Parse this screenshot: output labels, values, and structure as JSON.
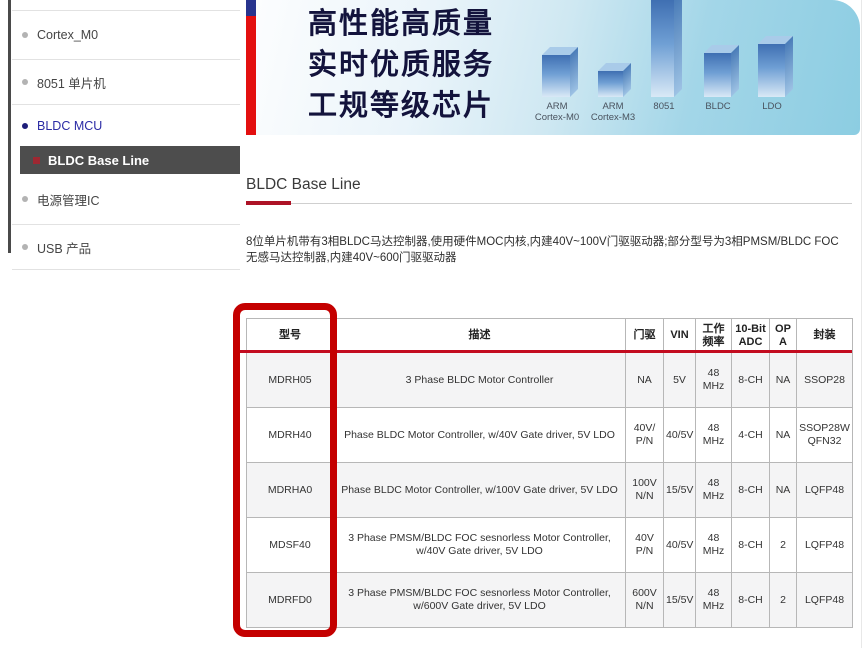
{
  "sidebar": {
    "items": [
      {
        "label": "Cortex_M0"
      },
      {
        "label": "8051 单片机"
      },
      {
        "label": "BLDC MCU"
      },
      {
        "label": "BLDC Base Line"
      },
      {
        "label": "电源管理IC"
      },
      {
        "label": "USB 产品"
      }
    ]
  },
  "banner": {
    "slogan_line1": "高性能高质量",
    "slogan_line2": "实时优质服务",
    "slogan_line3": "工规等级芯片",
    "chips": [
      {
        "label": "ARM\nCortex-M0"
      },
      {
        "label": "ARM\nCortex-M3"
      },
      {
        "label": "8051"
      },
      {
        "label": "BLDC"
      },
      {
        "label": "LDO"
      }
    ]
  },
  "page": {
    "title": "BLDC Base Line",
    "description": "8位单片机带有3相BLDC马达控制器,使用硬件MOC内核,内建40V~100V门驱驱动器;部分型号为3相PMSM/BLDC FOC\n无感马达控制器,内建40V~600门驱驱动器"
  },
  "table": {
    "headers": [
      "型号",
      "描述",
      "门驱",
      "VIN",
      "工作频率",
      "10-Bit ADC",
      "OPA",
      "封装"
    ],
    "rows": [
      {
        "model": "MDRH05",
        "description": "3 Phase BLDC Motor Controller",
        "gate": "NA",
        "vin": "5V",
        "freq": "48\nMHz",
        "adc": "8-CH",
        "opa": "NA",
        "package": "SSOP28"
      },
      {
        "model": "MDRH40",
        "description": "Phase BLDC Motor Controller, w/40V Gate driver, 5V LDO",
        "gate": "40V/\nP/N",
        "vin": "40/5V",
        "freq": "48\nMHz",
        "adc": "4-CH",
        "opa": "NA",
        "package": "SSOP28W\nQFN32"
      },
      {
        "model": "MDRHA0",
        "description": "Phase BLDC Motor Controller, w/100V Gate driver, 5V LDO",
        "gate": "100V\nN/N",
        "vin": "15/5V",
        "freq": "48\nMHz",
        "adc": "8-CH",
        "opa": "NA",
        "package": "LQFP48"
      },
      {
        "model": "MDSF40",
        "description": "3 Phase PMSM/BLDC FOC sesnorless Motor Controller,\nw/40V Gate driver, 5V LDO",
        "gate": "40V\nP/N",
        "vin": "40/5V",
        "freq": "48\nMHz",
        "adc": "8-CH",
        "opa": "2",
        "package": "LQFP48"
      },
      {
        "model": "MDRFD0",
        "description": "3 Phase PMSM/BLDC FOC sesnorless Motor Controller,\nw/600V Gate driver, 5V LDO",
        "gate": "600V\nN/N",
        "vin": "15/5V",
        "freq": "48\nMHz",
        "adc": "8-CH",
        "opa": "2",
        "package": "LQFP48"
      }
    ]
  },
  "colors": {
    "annotation_red": "#c40000",
    "header_rule_red": "#c30c20",
    "title_rule_red": "#ad1226",
    "banner_bar_red": "#e30f0f",
    "banner_bar_blue": "#28348e",
    "sidebar_selected_bg": "#4d4d4d",
    "sidebar_active_text": "#2b2ba5",
    "model_link_blue": "#5e8ac7",
    "row_alt_bg": "#f4f4f5",
    "banner_teal": "#8ccde2"
  }
}
